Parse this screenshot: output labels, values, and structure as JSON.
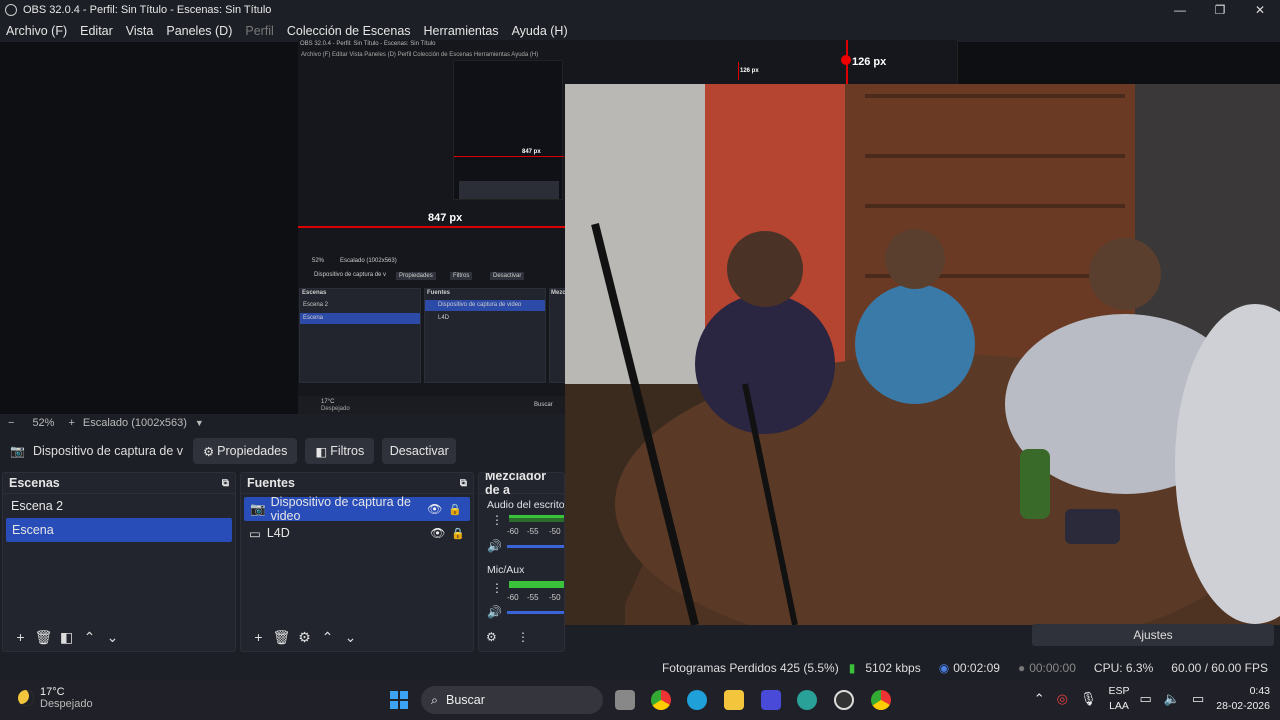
{
  "window": {
    "title": "OBS 32.0.4 - Perfil: Sin Título - Escenas: Sin Título"
  },
  "menu": [
    "Archivo (F)",
    "Editar",
    "Vista",
    "Paneles (D)",
    "Perfil",
    "Colección de Escenas",
    "Herramientas",
    "Ayuda (H)"
  ],
  "nested": {
    "title": "OBS 32.0.4 - Perfil: Sin Título - Escenas: Sin Título",
    "menu": "Archivo (F)   Editar   Vista   Paneles (D)   Perfil   Colección de Escenas   Herramientas   Ayuda (H)",
    "measure_h": "847 px",
    "measure_h_small": "847 px",
    "measure_v": "126 px",
    "measure_v_small": "126 px",
    "zoom": "52%",
    "scaled": "Escalado (1002x563)",
    "device": "Dispositivo de captura de v",
    "props": "Propiedades",
    "filters": "Filtros",
    "deactivate": "Desactivar",
    "scenes_header": "Escenas",
    "sources_header": "Fuentes",
    "mixer_header": "Mezclad",
    "scenes": [
      "Escena 2",
      "Escena"
    ],
    "sources": [
      "Dispositivo de captura de video",
      "L4D"
    ],
    "weather_temp": "17°C",
    "weather_desc": "Despejado",
    "search": "Buscar"
  },
  "status": {
    "zoom": "52%",
    "scaled": "Escalado (1002x563)"
  },
  "source_toolbar": {
    "device": "Dispositivo de captura de v",
    "props": "Propiedades",
    "filters": "Filtros",
    "deactivate": "Desactivar"
  },
  "scenes": {
    "header": "Escenas",
    "items": [
      "Escena 2",
      "Escena"
    ]
  },
  "sources": {
    "header": "Fuentes",
    "items": [
      "Dispositivo de captura de video",
      "L4D"
    ]
  },
  "mixer": {
    "header": "Mezclador de a",
    "channels": [
      {
        "label": "Audio del escritori"
      },
      {
        "label": "Mic/Aux"
      }
    ],
    "scale": [
      "-60",
      "-55",
      "-50"
    ]
  },
  "controls": {
    "settings": "Ajustes"
  },
  "bottom_status": {
    "dropped": "Fotogramas Perdidos 425 (5.5%)",
    "bitrate": "5102 kbps",
    "rec_time": "00:02:09",
    "stream_time": "00:00:00",
    "cpu": "CPU: 6.3%",
    "fps": "60.00 / 60.00 FPS"
  },
  "taskbar": {
    "weather_temp": "17°C",
    "weather_desc": "Despejado",
    "search": "Buscar",
    "lang1": "ESP",
    "lang2": "LAA",
    "time": "0:43",
    "date": "28-02-2026"
  },
  "colors": {
    "accent": "#284cb8",
    "bg": "#1d1f26",
    "panel": "#22252d",
    "meter": "#3bc23b",
    "measure": "#dd0000"
  }
}
